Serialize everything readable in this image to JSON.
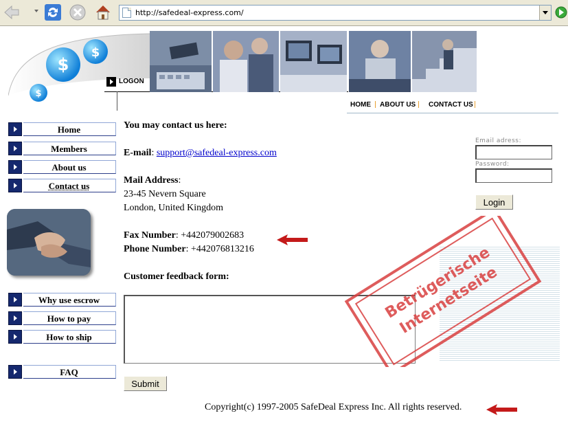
{
  "browser": {
    "url": "http://safedeal-express.com/",
    "icons": {
      "back": "back-arrow-icon",
      "forward": "forward-arrow-icon",
      "refresh": "refresh-icon",
      "stop": "stop-icon",
      "home": "home-icon",
      "go": "go-icon"
    }
  },
  "header": {
    "logon_label": "LOGON",
    "topnav": [
      "HOME",
      "ABOUT US",
      "CONTACT US"
    ]
  },
  "sidebar": {
    "items": [
      {
        "label": "Home"
      },
      {
        "label": "Members"
      },
      {
        "label": "About us"
      },
      {
        "label": "Contact us",
        "active": true
      }
    ],
    "items2": [
      {
        "label": "Why use escrow"
      },
      {
        "label": "How to pay"
      },
      {
        "label": "How to ship"
      }
    ],
    "faq": "FAQ"
  },
  "content": {
    "intro": "You may contact us here:",
    "email_label": "E-mail",
    "email_value": "support@safedeal-express.com",
    "mail_label": "Mail Address",
    "address_line1": "23-45 Nevern Square",
    "address_line2": "London, United Kingdom",
    "fax_label": "Fax Number",
    "fax_value": "+442079002683",
    "phone_label": "Phone Number",
    "phone_value": "+442076813216",
    "feedback_title": "Customer feedback form:",
    "feedback_value": "",
    "submit_label": "Submit"
  },
  "login": {
    "email_label": "Email adress:",
    "email_value": "",
    "password_label": "Password:",
    "password_value": "",
    "button_label": "Login"
  },
  "stamp": {
    "line1": "Betrügerische",
    "line2": "Internetseite",
    "color": "#d94040"
  },
  "footer": {
    "copyright": "Copyright(c) 1997-2005 SafeDeal Express Inc. All rights reserved."
  },
  "colors": {
    "nav_icon": "#15286e",
    "link": "#0000cc",
    "warning_arrow": "#c41a1a"
  }
}
